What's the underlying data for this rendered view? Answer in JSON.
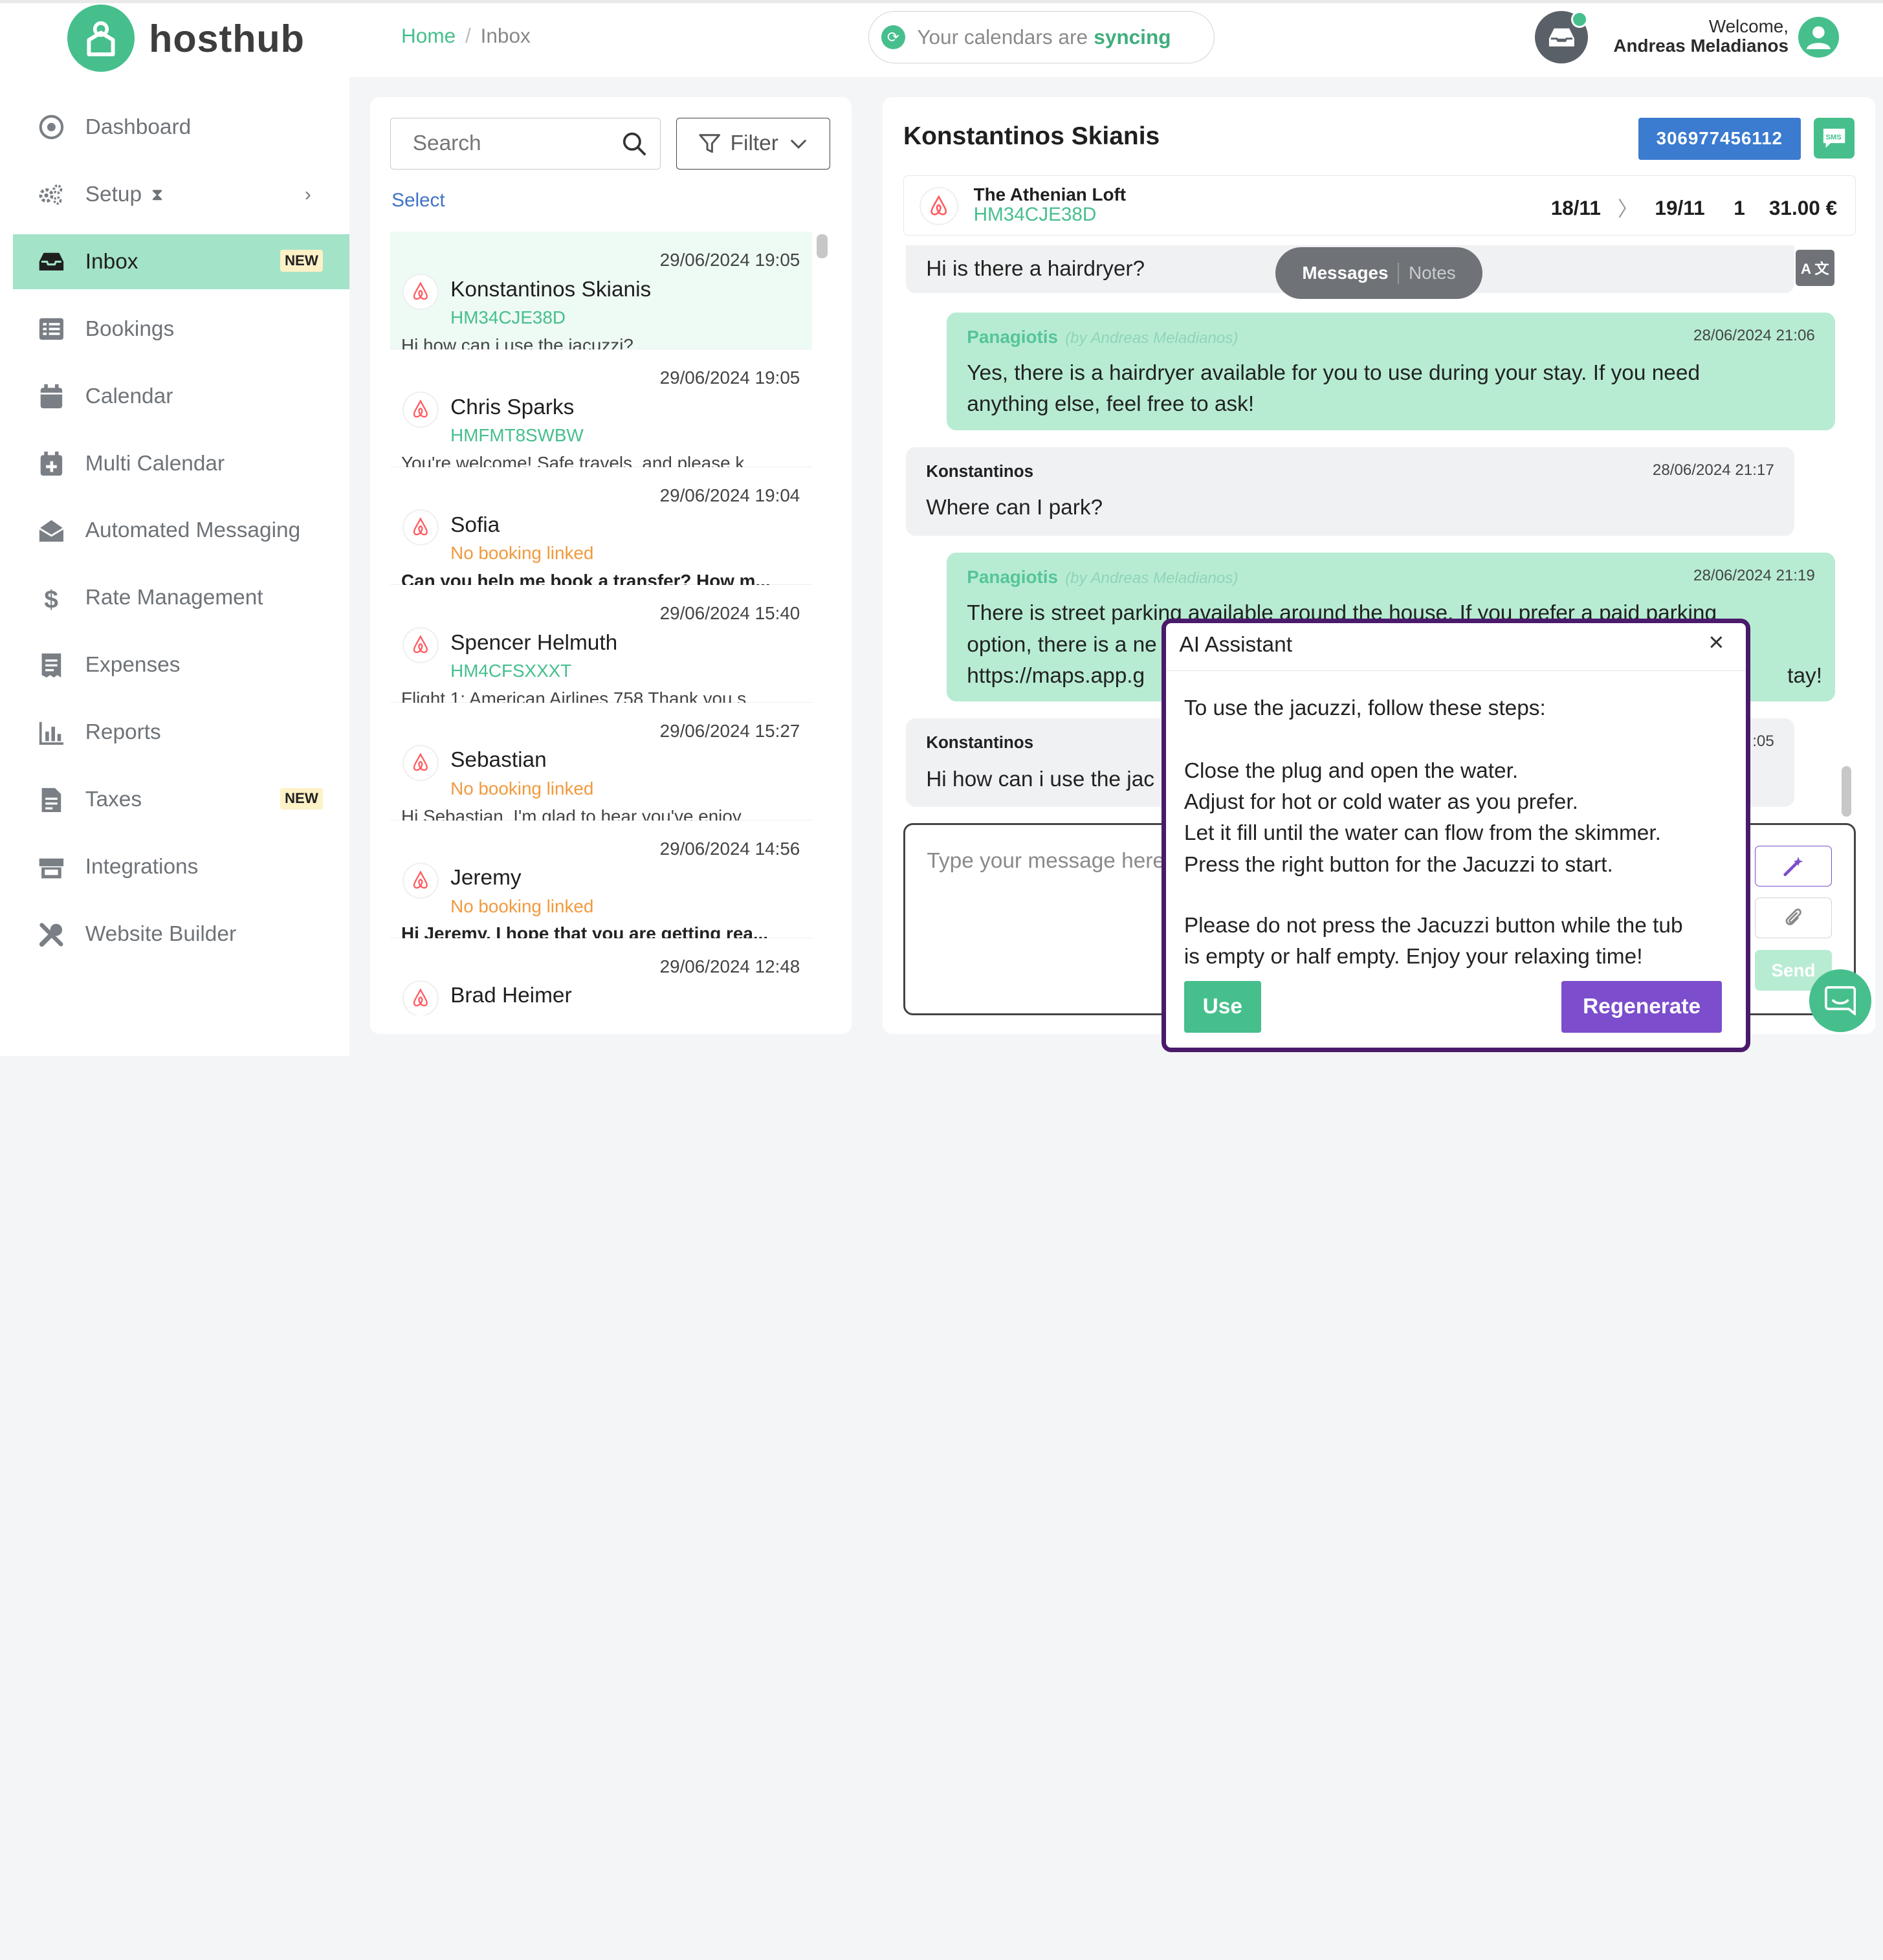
{
  "brand": {
    "name": "hosthub",
    "color": "#46bf8d"
  },
  "breadcrumb": {
    "home": "Home",
    "separator": "/",
    "current": "Inbox"
  },
  "sync": {
    "text": "Your calendars are",
    "status": "syncing"
  },
  "user": {
    "welcome": "Welcome,",
    "name": "Andreas Meladianos"
  },
  "sidebar": {
    "items": [
      {
        "label": "Dashboard",
        "icon": "dashboard-icon"
      },
      {
        "label": "Setup",
        "icon": "gears-icon",
        "suffix": "⧗"
      },
      {
        "label": "Inbox",
        "icon": "inbox-icon",
        "badge": "NEW",
        "active": true
      },
      {
        "label": "Bookings",
        "icon": "list-icon"
      },
      {
        "label": "Calendar",
        "icon": "calendar-icon"
      },
      {
        "label": "Multi Calendar",
        "icon": "calendar-plus-icon"
      },
      {
        "label": "Automated Messaging",
        "icon": "envelope-open-icon"
      },
      {
        "label": "Rate Management",
        "icon": "dollar-icon"
      },
      {
        "label": "Expenses",
        "icon": "receipt-icon"
      },
      {
        "label": "Reports",
        "icon": "bar-chart-icon"
      },
      {
        "label": "Taxes",
        "icon": "document-icon",
        "badge": "NEW"
      },
      {
        "label": "Integrations",
        "icon": "store-icon"
      },
      {
        "label": "Website Builder",
        "icon": "tools-icon"
      }
    ]
  },
  "list": {
    "search_placeholder": "Search",
    "filter_label": "Filter",
    "select_label": "Select",
    "conversations": [
      {
        "name": "Konstantinos Skianis",
        "date": "29/06/2024 19:05",
        "code": "HM34CJE38D",
        "preview": "Hi how can i use the jacuzzi?",
        "bold": false,
        "linked": true
      },
      {
        "name": "Chris Sparks",
        "date": "29/06/2024 19:05",
        "code": "HMFMT8SWBW",
        "preview": "You're welcome! Safe travels, and please k...",
        "bold": false,
        "linked": true
      },
      {
        "name": "Sofia",
        "date": "29/06/2024 19:04",
        "code": "No booking linked",
        "preview": "Can you help me book a transfer? How m...",
        "bold": true,
        "linked": false
      },
      {
        "name": "Spencer Helmuth",
        "date": "29/06/2024 15:40",
        "code": "HM4CFSXXXT",
        "preview": "Flight 1: American Airlines 758 Thank you s...",
        "bold": false,
        "linked": true
      },
      {
        "name": "Sebastian",
        "date": "29/06/2024 15:27",
        "code": "No booking linked",
        "preview": "Hi Sebastian, I'm glad to hear you've enjoy..",
        "bold": false,
        "linked": false
      },
      {
        "name": "Jeremy",
        "date": "29/06/2024 14:56",
        "code": "No booking linked",
        "preview": "Hi Jeremy, I hope that you are getting rea...",
        "bold": true,
        "linked": false
      },
      {
        "name": "Brad Heimer",
        "date": "29/06/2024 12:48",
        "code": "",
        "preview": "",
        "bold": false,
        "linked": true
      }
    ]
  },
  "chat": {
    "guest_name": "Konstantinos Skianis",
    "phone": "306977456112",
    "sms_label": "SMS",
    "booking": {
      "property": "The Athenian Loft",
      "code": "HM34CJE38D",
      "checkin": "18/11",
      "checkout": "19/11",
      "guests": "1",
      "price": "31.00 €"
    },
    "toggle": {
      "messages": "Messages",
      "notes": "Notes"
    },
    "translate_label": "A 文",
    "messages": [
      {
        "type": "in",
        "text": "Hi is there a hairdryer?"
      },
      {
        "type": "out",
        "sender": "Panagiotis",
        "by": "(by Andreas Meladianos)",
        "time": "28/06/2024 21:06",
        "lines": [
          "Yes, there is a hairdryer available for you to use during your stay. If you need",
          "anything else, feel free to ask!"
        ]
      },
      {
        "type": "in",
        "sender": "Konstantinos",
        "time": "28/06/2024 21:17",
        "text": "Where can I park?"
      },
      {
        "type": "out",
        "sender": "Panagiotis",
        "by": "(by Andreas Meladianos)",
        "time": "28/06/2024 21:19",
        "lines": [
          "There is street parking available around the house. If you prefer a paid parking",
          "option, there is a ne",
          "https://maps.app.g"
        ],
        "tail": "tay!"
      },
      {
        "type": "in",
        "sender": "Konstantinos",
        "time": "…:05",
        "text": "Hi how can i use the jac"
      }
    ],
    "composer_placeholder": "Type your message here",
    "send_label": "Send"
  },
  "ai_modal": {
    "title": "AI Assistant",
    "close": "×",
    "lines": [
      "To use the jacuzzi, follow these steps:",
      "",
      "Close the plug and open the water.",
      "Adjust for hot or cold water as you prefer.",
      "Let it fill until the water can flow from the skimmer.",
      "Press the right button for the Jacuzzi to start.",
      "",
      "Please do not press the Jacuzzi button while the tub",
      "is empty or half empty. Enjoy your relaxing time!"
    ],
    "use_label": "Use",
    "regenerate_label": "Regenerate"
  },
  "colors": {
    "accent": "#46bf8d",
    "active_nav": "#a3e3c8",
    "phone_button": "#3b7bd0",
    "regenerate": "#7c4dcc",
    "modal_border": "#4a1a6b",
    "no_booking": "#f19a3e"
  }
}
